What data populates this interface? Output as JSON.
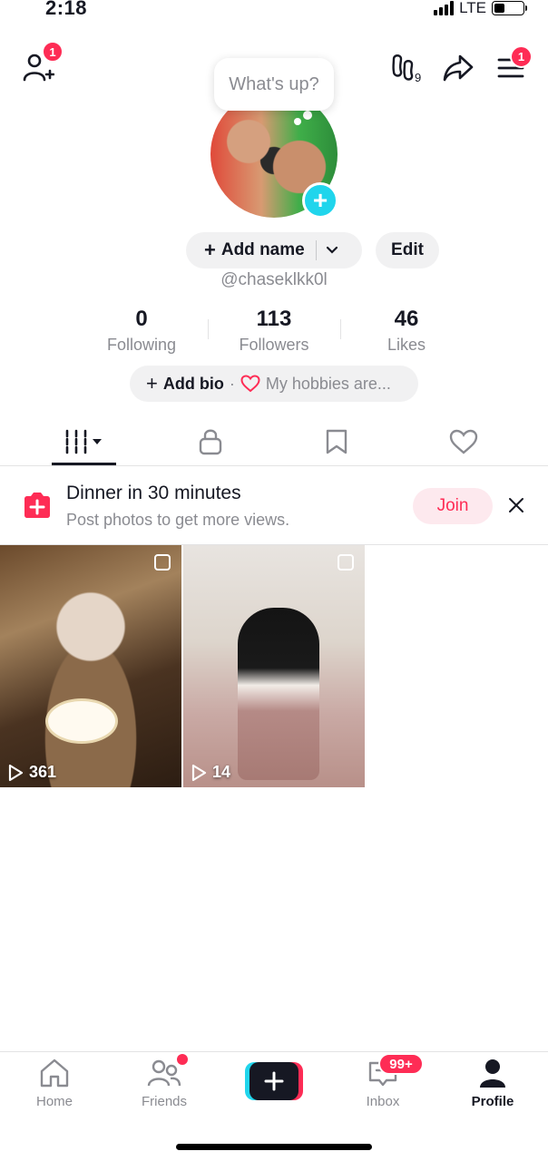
{
  "status_bar": {
    "time": "2:18",
    "network": "LTE"
  },
  "header": {
    "friends_badge": "1",
    "menu_badge": "1"
  },
  "profile": {
    "bubble_text": "What's up?",
    "add_name_label": "Add name",
    "edit_label": "Edit",
    "handle": "@chaseklkk0l",
    "stats": [
      {
        "value": "0",
        "label": "Following"
      },
      {
        "value": "113",
        "label": "Followers"
      },
      {
        "value": "46",
        "label": "Likes"
      }
    ],
    "add_bio_label": "Add bio",
    "bio_separator": "·",
    "bio_placeholder": "My hobbies are..."
  },
  "banner": {
    "title": "Dinner in 30 minutes",
    "subtitle": "Post photos to get more views.",
    "join_label": "Join"
  },
  "videos": [
    {
      "views": "361"
    },
    {
      "views": "14"
    }
  ],
  "bottom_nav": {
    "items": [
      {
        "label": "Home"
      },
      {
        "label": "Friends"
      },
      {
        "label": "Inbox",
        "badge": "99+"
      },
      {
        "label": "Profile"
      }
    ]
  },
  "colors": {
    "accent": "#fe2c55",
    "cyan": "#20d5ec",
    "text": "#161823",
    "muted": "#8a8b91"
  }
}
